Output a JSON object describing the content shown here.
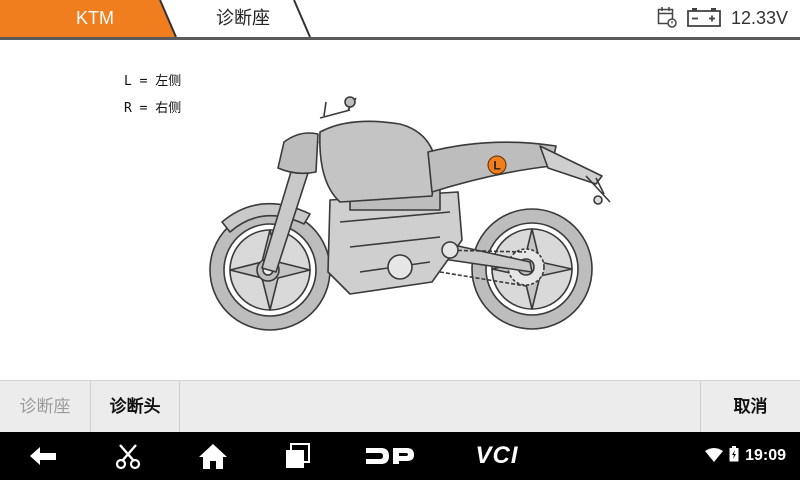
{
  "header": {
    "brand": "KTM",
    "page_title": "诊断座",
    "voltage": "12.33V",
    "accent_color": "#f07d1e"
  },
  "legend": {
    "left_line": "L = 左侧",
    "right_line": "R = 右侧"
  },
  "diagram": {
    "marker_label": "L",
    "marker_color": "#f07d1e"
  },
  "toolbar": {
    "diag_seat_label": "诊断座",
    "diag_head_label": "诊断头",
    "cancel_label": "取消"
  },
  "navbar": {
    "dp_label": "DP",
    "vci_label": "VCI",
    "time": "19:09"
  }
}
